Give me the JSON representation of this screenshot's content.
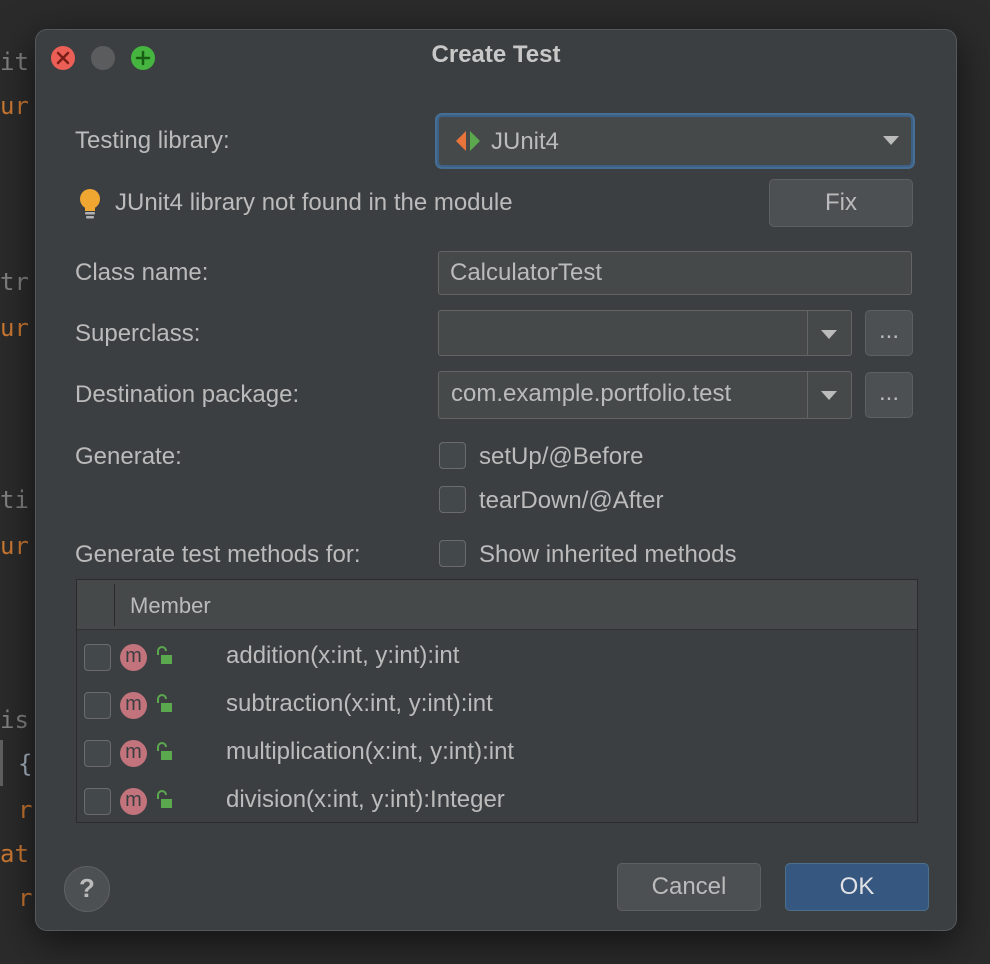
{
  "editor": {
    "fragments": [
      "it",
      "ur",
      "tr",
      "ur",
      "ti",
      "ur",
      "is",
      "{",
      "r",
      "at",
      "r"
    ]
  },
  "dialog": {
    "title": "Create Test",
    "testing_library": {
      "label": "Testing library:",
      "value": "JUnit4",
      "icon": "junit-icon"
    },
    "warning": {
      "text": "JUnit4 library not found in the module",
      "icon": "lightbulb-icon",
      "fix_label": "Fix"
    },
    "class_name": {
      "label": "Class name:",
      "value": "CalculatorTest"
    },
    "superclass": {
      "label": "Superclass:",
      "value": "",
      "browse_label": "..."
    },
    "destination_package": {
      "label": "Destination package:",
      "value": "com.example.portfolio.test",
      "browse_label": "..."
    },
    "generate": {
      "label": "Generate:",
      "options": [
        {
          "label": "setUp/@Before",
          "checked": false
        },
        {
          "label": "tearDown/@After",
          "checked": false
        }
      ]
    },
    "methods_for": {
      "label": "Generate test methods for:",
      "show_inherited_label": "Show inherited methods",
      "show_inherited_checked": false
    },
    "table": {
      "column_header": "Member",
      "rows": [
        {
          "badge": "m",
          "signature": "addition(x:int, y:int):int",
          "checked": false
        },
        {
          "badge": "m",
          "signature": "subtraction(x:int, y:int):int",
          "checked": false
        },
        {
          "badge": "m",
          "signature": "multiplication(x:int, y:int):int",
          "checked": false
        },
        {
          "badge": "m",
          "signature": "division(x:int, y:int):Integer",
          "checked": false
        }
      ]
    },
    "footer": {
      "help_label": "?",
      "cancel_label": "Cancel",
      "ok_label": "OK"
    }
  },
  "colors": {
    "dialog_bg": "#3c3f41",
    "accent_focus": "#466d94",
    "ok_button": "#365880",
    "method_badge": "#c2737c",
    "lock_green": "#5ba84f"
  }
}
